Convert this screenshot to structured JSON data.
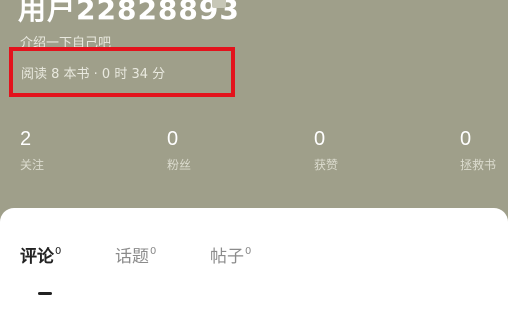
{
  "profile": {
    "username": "用户22828893",
    "bio": "介绍一下自己吧",
    "reading_stats": "阅读 8 本书 · 0 时 34 分"
  },
  "stats": [
    {
      "value": "2",
      "label": "关注"
    },
    {
      "value": "0",
      "label": "粉丝"
    },
    {
      "value": "0",
      "label": "获赞"
    },
    {
      "value": "0",
      "label": "拯救书"
    }
  ],
  "tabs": [
    {
      "label": "评论",
      "count": "0",
      "active": true
    },
    {
      "label": "话题",
      "count": "0",
      "active": false
    },
    {
      "label": "帖子",
      "count": "0",
      "active": false
    }
  ],
  "colors": {
    "header_bg": "#9f9f8a",
    "highlight": "#e3121c",
    "card_bg": "#ffffff"
  }
}
